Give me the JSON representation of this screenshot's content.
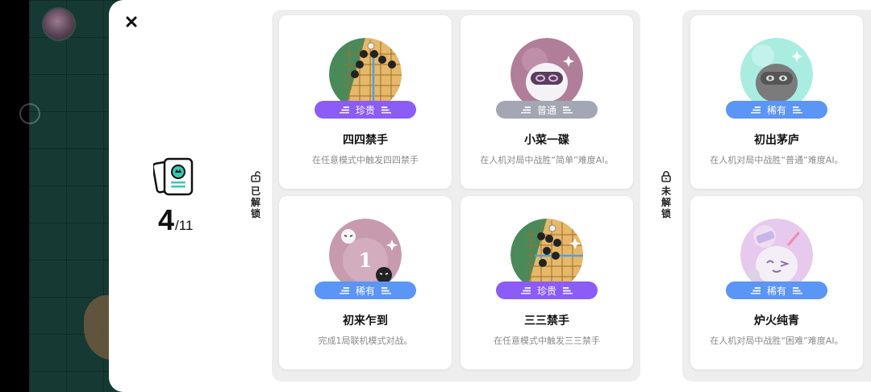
{
  "summary": {
    "unlocked_count": "4",
    "total": "/11"
  },
  "sections": {
    "unlocked_label": "已解锁",
    "locked_label": "未解锁"
  },
  "achievements": [
    {
      "title": "四四禁手",
      "description": "在任意模式中触发四四禁手",
      "rarity": "珍贵",
      "icon": "go-board-four-four-icon",
      "unlocked": true
    },
    {
      "title": "小菜一碟",
      "description": "在人机对局中战胜“简单”难度AI。",
      "rarity": "普通",
      "icon": "pink-robot-icon",
      "unlocked": true
    },
    {
      "title": "初出茅庐",
      "description": "在人机对局中战胜“普通”难度AI。",
      "rarity": "稀有",
      "icon": "gray-robot-icon",
      "unlocked": false
    },
    {
      "title": "初来乍到",
      "description": "完成1局联机模式对战。",
      "rarity": "稀有",
      "icon": "first-match-icon",
      "unlocked": true
    },
    {
      "title": "三三禁手",
      "description": "在任意模式中触发三三禁手",
      "rarity": "珍贵",
      "icon": "go-board-three-three-icon",
      "unlocked": true
    },
    {
      "title": "炉火纯青",
      "description": "在人机对局中战胜“困难”难度AI。",
      "rarity": "稀有",
      "icon": "winking-robot-icon",
      "unlocked": false
    }
  ],
  "colors": {
    "precious": "#8b5cf6",
    "common": "#a2a7b3",
    "rare": "#5b95f5"
  }
}
